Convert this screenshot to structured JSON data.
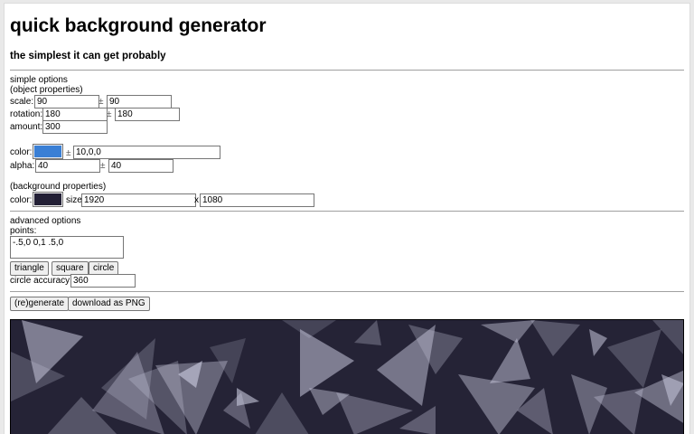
{
  "header": {
    "title": "quick background generator",
    "subtitle": "the simplest it can get probably"
  },
  "simple": {
    "heading": "simple options",
    "object_heading": "(object properties)",
    "scale_label": "scale:",
    "scale_value": "90",
    "scale_pm": "±",
    "scale_var": "90",
    "rotation_label": "rotation:",
    "rotation_value": "180",
    "rotation_pm": "±",
    "rotation_var": "180",
    "amount_label": "amount:",
    "amount_value": "300",
    "color_label": "color:",
    "color_value": "#3a7fd5",
    "color_pm": "±",
    "color_var": "10,0,0",
    "alpha_label": "alpha:",
    "alpha_value": "40",
    "alpha_pm": "±",
    "alpha_var": "40",
    "bg_heading": "(background properties)",
    "bg_color_label": "color:",
    "bg_color_value": "#232036",
    "size_label": "size:",
    "size_width": "1920",
    "size_x": "x",
    "size_height": "1080"
  },
  "advanced": {
    "heading": "advanced options",
    "points_label": "points:",
    "points_value": "-.5,0 0,1 .5,0",
    "triangle_label": "triangle",
    "square_label": "square",
    "circle_label": "circle",
    "accuracy_label": "circle accuracy:",
    "accuracy_value": "360"
  },
  "actions": {
    "regenerate_label": "(re)generate",
    "download_label": "download as PNG"
  },
  "preview": {
    "background": "#252336",
    "shape_color": "#c8c8dc"
  }
}
